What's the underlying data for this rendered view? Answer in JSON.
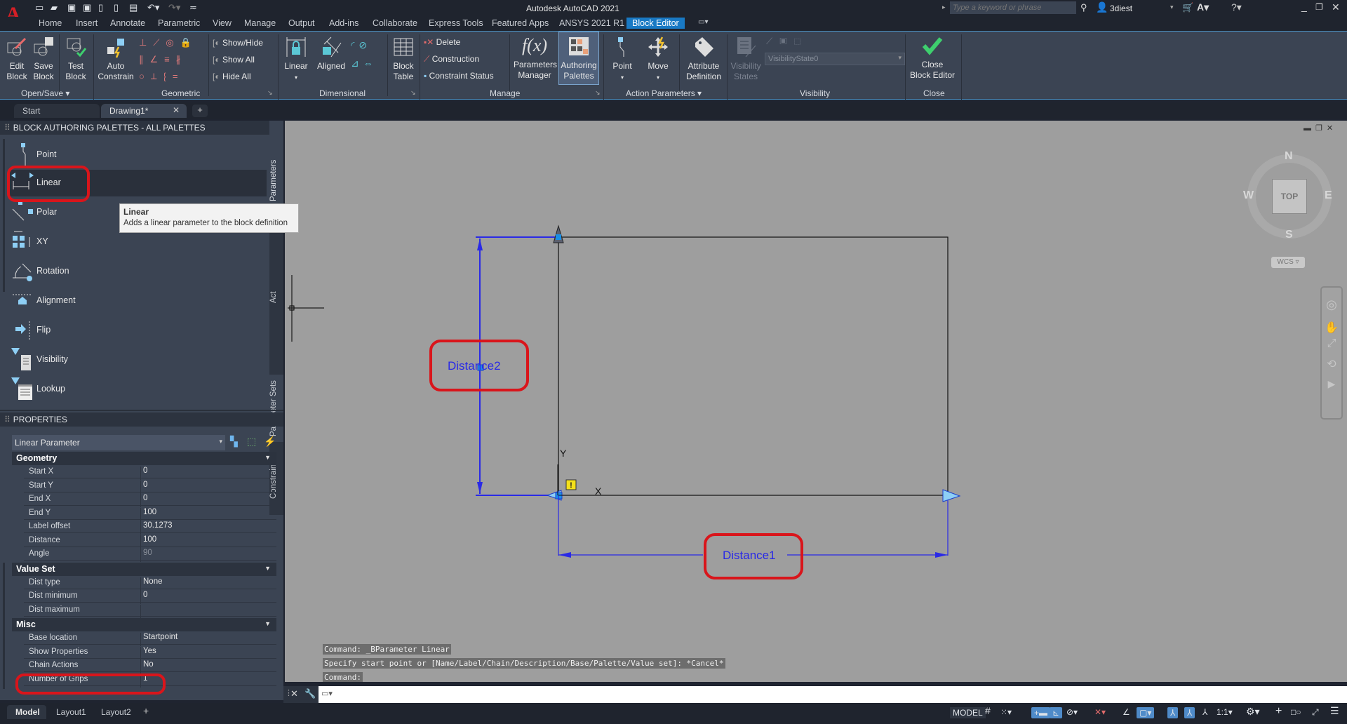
{
  "app": {
    "title": "Autodesk AutoCAD 2021",
    "search_placeholder": "Type a keyword or phrase",
    "user": "3diest"
  },
  "menu_tabs": [
    "Home",
    "Insert",
    "Annotate",
    "Parametric",
    "View",
    "Manage",
    "Output",
    "Add-ins",
    "Collaborate",
    "Express Tools",
    "Featured Apps",
    "ANSYS  2021 R1",
    "Block Editor"
  ],
  "active_menu_tab": "Block Editor",
  "ribbon": {
    "open_save": {
      "title": "Open/Save",
      "edit_block": "Edit\nBlock",
      "save_block": "Save\nBlock",
      "test_block": "Test\nBlock"
    },
    "geometric": {
      "title": "Geometric",
      "auto_constrain": "Auto\nConstrain",
      "show_hide": "Show/Hide",
      "show_all": "Show All",
      "hide_all": "Hide All"
    },
    "dimensional": {
      "title": "Dimensional",
      "linear": "Linear",
      "aligned": "Aligned",
      "block_table": "Block\nTable"
    },
    "manage": {
      "title": "Manage",
      "delete": "Delete",
      "construction": "Construction",
      "constraint_status": "Constraint Status",
      "parameters_manager": "Parameters\nManager",
      "authoring_palettes": "Authoring\nPalettes"
    },
    "action_parameters": {
      "title": "Action Parameters",
      "point": "Point",
      "move": "Move",
      "attribute_definition": "Attribute\nDefinition"
    },
    "visibility": {
      "title": "Visibility",
      "visibility_states": "Visibility\nStates",
      "state_value": "VisibilityState0"
    },
    "close": {
      "title": "Close",
      "close_block_editor": "Close\nBlock Editor"
    }
  },
  "doc_tabs": [
    {
      "label": "Start"
    },
    {
      "label": "Drawing1*",
      "active": true
    }
  ],
  "palette": {
    "title": "BLOCK AUTHORING PALETTES - ALL PALETTES",
    "items": [
      {
        "label": "Point",
        "icon": "point-parameter-icon"
      },
      {
        "label": "Linear",
        "icon": "linear-parameter-icon",
        "highlighted": true
      },
      {
        "label": "Polar",
        "icon": "polar-parameter-icon"
      },
      {
        "label": "XY",
        "icon": "xy-parameter-icon"
      },
      {
        "label": "Rotation",
        "icon": "rotation-parameter-icon"
      },
      {
        "label": "Alignment",
        "icon": "alignment-parameter-icon"
      },
      {
        "label": "Flip",
        "icon": "flip-parameter-icon"
      },
      {
        "label": "Visibility",
        "icon": "visibility-parameter-icon"
      },
      {
        "label": "Lookup",
        "icon": "lookup-parameter-icon"
      }
    ],
    "side_tabs": [
      "Parameters",
      "Act",
      "Parameter Sets",
      "Constraints"
    ],
    "tooltip": {
      "title": "Linear",
      "body": "Adds a linear parameter to the block definition"
    }
  },
  "properties": {
    "title": "PROPERTIES",
    "selector": "Linear Parameter",
    "groups": [
      {
        "name": "Geometry",
        "rows": [
          {
            "k": "Start X",
            "v": "0"
          },
          {
            "k": "Start Y",
            "v": "0"
          },
          {
            "k": "End X",
            "v": "0"
          },
          {
            "k": "End Y",
            "v": "100"
          },
          {
            "k": "Label offset",
            "v": "30.1273"
          },
          {
            "k": "Distance",
            "v": "100"
          },
          {
            "k": "Angle",
            "v": "90"
          }
        ]
      },
      {
        "name": "Value Set",
        "rows": [
          {
            "k": "Dist type",
            "v": "None"
          },
          {
            "k": "Dist minimum",
            "v": "0"
          },
          {
            "k": "Dist maximum",
            "v": ""
          }
        ]
      },
      {
        "name": "Misc",
        "rows": [
          {
            "k": "Base location",
            "v": "Startpoint"
          },
          {
            "k": "Show Properties",
            "v": "Yes"
          },
          {
            "k": "Chain Actions",
            "v": "No"
          },
          {
            "k": "Number of Grips",
            "v": "1"
          }
        ]
      }
    ]
  },
  "drawing": {
    "label_distance1": "Distance1",
    "label_distance2": "Distance2",
    "ucs_x": "X",
    "ucs_y": "Y",
    "viewcube": {
      "n": "N",
      "s": "S",
      "e": "E",
      "w": "W",
      "face": "TOP",
      "ucs": "WCS"
    }
  },
  "command": {
    "history": [
      "Command: _BParameter Linear",
      "Specify start point or [Name/Label/Chain/Description/Base/Palette/Value set]: *Cancel*",
      "Command:"
    ],
    "input_value": ""
  },
  "layout_tabs": [
    {
      "label": "Model",
      "active": true
    },
    {
      "label": "Layout1"
    },
    {
      "label": "Layout2"
    }
  ],
  "status": {
    "model": "MODEL",
    "scale": "1:1"
  },
  "colors": {
    "accent": "#1979c4",
    "param_blue": "#2a2ae6",
    "highlight_red": "#d9151b",
    "confirm_green": "#3ecf6e"
  }
}
